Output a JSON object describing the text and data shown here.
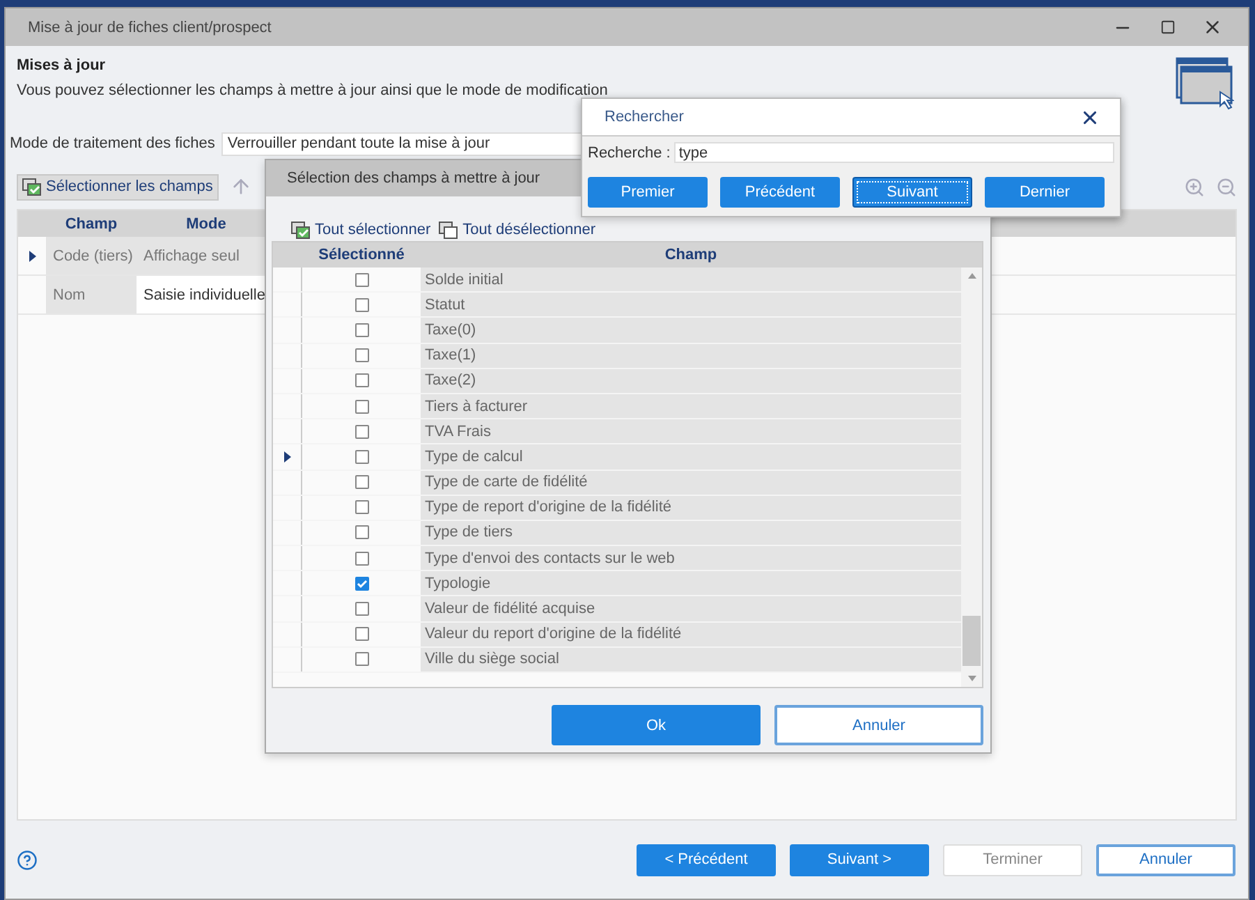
{
  "window": {
    "title": "Mise à jour de fiches client/prospect"
  },
  "header": {
    "title": "Mises à jour",
    "description": "Vous pouvez sélectionner les champs à mettre à jour ainsi que le mode de modification"
  },
  "processing_mode": {
    "label": "Mode de traitement des fiches",
    "value": "Verrouiller pendant toute la mise à jour"
  },
  "toolbar": {
    "select_fields": "Sélectionner les champs"
  },
  "fields_table": {
    "columns": [
      "Champ",
      "Mode"
    ],
    "rows": [
      {
        "field": "Code (tiers)",
        "mode": "Affichage seul",
        "selected": true
      },
      {
        "field": "Nom",
        "mode": "Saisie individuelle",
        "selected": false
      }
    ]
  },
  "footer_buttons": [
    {
      "label": "< Précédent",
      "kind": "primary"
    },
    {
      "label": "Suivant >",
      "kind": "primary"
    },
    {
      "label": "Terminer",
      "kind": "disabled"
    },
    {
      "label": "Annuler",
      "kind": "outline"
    }
  ],
  "field_dialog": {
    "title": "Sélection des champs à mettre à jour",
    "select_all": "Tout sélectionner",
    "deselect_all": "Tout désélectionner",
    "columns": [
      "Sélectionné",
      "Champ"
    ],
    "rows": [
      {
        "name": "Solde initial",
        "checked": false,
        "selected": false
      },
      {
        "name": "Statut",
        "checked": false,
        "selected": false
      },
      {
        "name": "Taxe(0)",
        "checked": false,
        "selected": false
      },
      {
        "name": "Taxe(1)",
        "checked": false,
        "selected": false
      },
      {
        "name": "Taxe(2)",
        "checked": false,
        "selected": false
      },
      {
        "name": "Tiers à facturer",
        "checked": false,
        "selected": false
      },
      {
        "name": "TVA Frais",
        "checked": false,
        "selected": false
      },
      {
        "name": "Type de calcul",
        "checked": false,
        "selected": true
      },
      {
        "name": "Type de carte de fidélité",
        "checked": false,
        "selected": false
      },
      {
        "name": "Type de report d'origine de la fidélité",
        "checked": false,
        "selected": false
      },
      {
        "name": "Type de tiers",
        "checked": false,
        "selected": false
      },
      {
        "name": "Type d'envoi des contacts sur le web",
        "checked": false,
        "selected": false
      },
      {
        "name": "Typologie",
        "checked": true,
        "selected": false
      },
      {
        "name": "Valeur de fidélité acquise",
        "checked": false,
        "selected": false
      },
      {
        "name": "Valeur du report d'origine de la fidélité",
        "checked": false,
        "selected": false
      },
      {
        "name": "Ville du siège social",
        "checked": false,
        "selected": false
      }
    ],
    "buttons": [
      {
        "label": "Ok",
        "kind": "primary"
      },
      {
        "label": "Annuler",
        "kind": "outline"
      }
    ]
  },
  "search_dialog": {
    "title": "Rechercher",
    "label": "Recherche :",
    "value": "type",
    "buttons": [
      {
        "label": "Premier",
        "focused": false
      },
      {
        "label": "Précédent",
        "focused": false
      },
      {
        "label": "Suivant",
        "focused": true
      },
      {
        "label": "Dernier",
        "focused": false
      }
    ]
  }
}
